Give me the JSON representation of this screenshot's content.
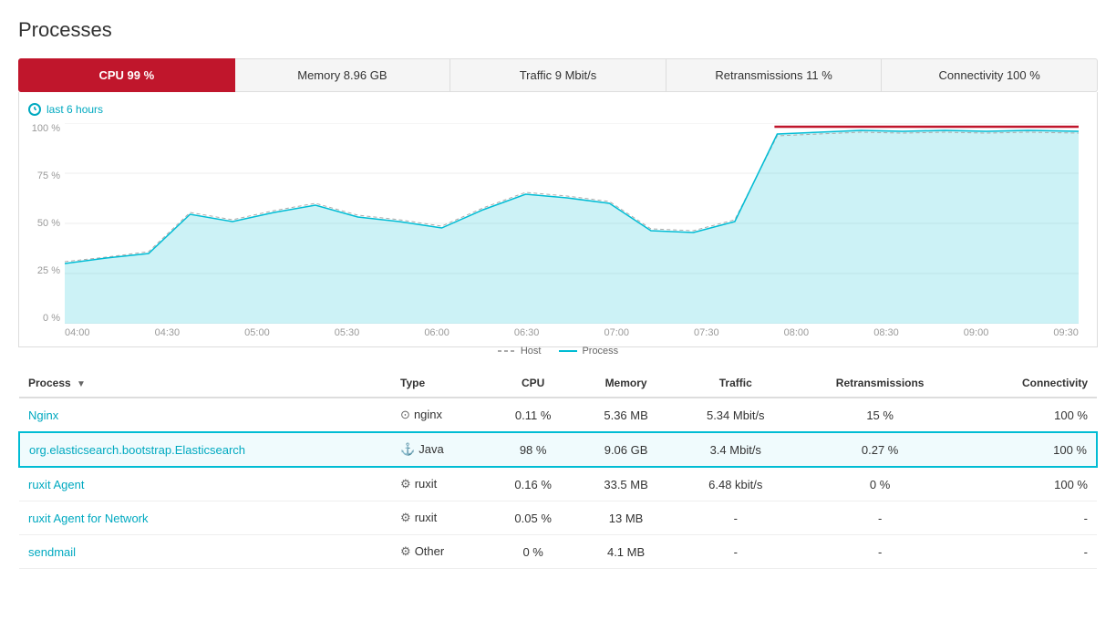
{
  "page": {
    "title": "Processes"
  },
  "tabs": [
    {
      "id": "cpu",
      "label": "CPU 99 %",
      "active": true
    },
    {
      "id": "memory",
      "label": "Memory 8.96 GB",
      "active": false
    },
    {
      "id": "traffic",
      "label": "Traffic 9 Mbit/s",
      "active": false
    },
    {
      "id": "retransmissions",
      "label": "Retransmissions 11 %",
      "active": false
    },
    {
      "id": "connectivity",
      "label": "Connectivity 100 %",
      "active": false
    }
  ],
  "chart": {
    "time_range": "last 6 hours",
    "y_labels": [
      "100 %",
      "75 %",
      "50 %",
      "25 %",
      "0 %"
    ],
    "x_labels": [
      "04:00",
      "04:30",
      "05:00",
      "05:30",
      "06:00",
      "06:30",
      "07:00",
      "07:30",
      "08:00",
      "08:30",
      "09:00",
      "09:30"
    ],
    "legend": {
      "host": "Host",
      "process": "Process"
    }
  },
  "table": {
    "columns": [
      {
        "id": "process",
        "label": "Process",
        "sortable": true
      },
      {
        "id": "type",
        "label": "Type"
      },
      {
        "id": "cpu",
        "label": "CPU"
      },
      {
        "id": "memory",
        "label": "Memory"
      },
      {
        "id": "traffic",
        "label": "Traffic"
      },
      {
        "id": "retransmissions",
        "label": "Retransmissions"
      },
      {
        "id": "connectivity",
        "label": "Connectivity"
      }
    ],
    "rows": [
      {
        "process": "Nginx",
        "process_link": true,
        "type_icon": "⊙",
        "type": "nginx",
        "cpu": "0.11 %",
        "memory": "5.36 MB",
        "traffic": "5.34 Mbit/s",
        "retransmissions": "15 %",
        "connectivity": "100 %",
        "highlighted": false
      },
      {
        "process": "org.elasticsearch.bootstrap.Elasticsearch",
        "process_link": true,
        "type_icon": "⚓",
        "type": "Java",
        "cpu": "98 %",
        "memory": "9.06 GB",
        "traffic": "3.4 Mbit/s",
        "retransmissions": "0.27 %",
        "connectivity": "100 %",
        "highlighted": true
      },
      {
        "process": "ruxit Agent",
        "process_link": true,
        "type_icon": "⚙",
        "type": "ruxit",
        "cpu": "0.16 %",
        "memory": "33.5 MB",
        "traffic": "6.48 kbit/s",
        "retransmissions": "0 %",
        "connectivity": "100 %",
        "highlighted": false
      },
      {
        "process": "ruxit Agent for Network",
        "process_link": true,
        "type_icon": "⚙",
        "type": "ruxit",
        "cpu": "0.05 %",
        "memory": "13 MB",
        "traffic": "-",
        "retransmissions": "-",
        "connectivity": "-",
        "highlighted": false
      },
      {
        "process": "sendmail",
        "process_link": true,
        "type_icon": "⚙",
        "type": "Other",
        "cpu": "0 %",
        "memory": "4.1 MB",
        "traffic": "-",
        "retransmissions": "-",
        "connectivity": "-",
        "highlighted": false
      }
    ]
  }
}
